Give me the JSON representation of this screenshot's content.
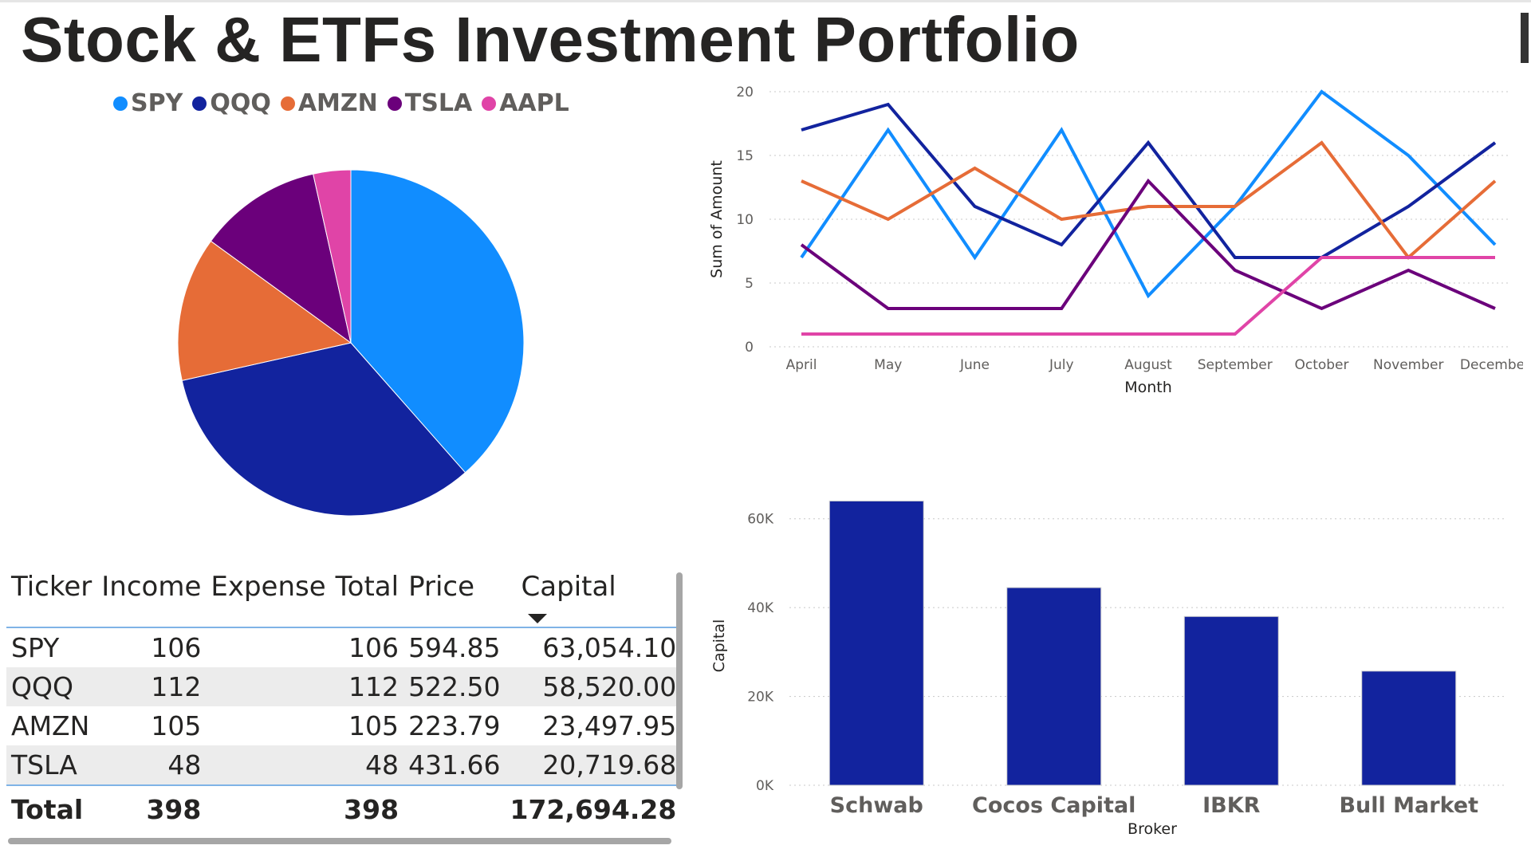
{
  "title": "Stock & ETFs Investment Portfolio",
  "colors": {
    "SPY": "#118dff",
    "QQQ": "#12239e",
    "AMZN": "#e66c37",
    "TSLA": "#6b007b",
    "AAPL": "#e044a7",
    "bar": "#12239e"
  },
  "legend": [
    "SPY",
    "QQQ",
    "AMZN",
    "TSLA",
    "AAPL"
  ],
  "chart_data": [
    {
      "type": "pie",
      "categories": [
        "SPY",
        "QQQ",
        "AMZN",
        "TSLA",
        "AAPL"
      ],
      "values": [
        38.5,
        33.0,
        13.5,
        11.5,
        3.5
      ],
      "legend_position": "top"
    },
    {
      "type": "line",
      "x": [
        "April",
        "May",
        "June",
        "July",
        "August",
        "September",
        "October",
        "November",
        "December"
      ],
      "series": [
        {
          "name": "SPY",
          "values": [
            7,
            17,
            7,
            17,
            4,
            11,
            20,
            15,
            8
          ]
        },
        {
          "name": "QQQ",
          "values": [
            17,
            19,
            11,
            8,
            16,
            7,
            7,
            11,
            16
          ]
        },
        {
          "name": "AMZN",
          "values": [
            13,
            10,
            14,
            10,
            11,
            11,
            16,
            7,
            13
          ]
        },
        {
          "name": "TSLA",
          "values": [
            8,
            3,
            3,
            3,
            13,
            6,
            3,
            6,
            3
          ]
        },
        {
          "name": "AAPL",
          "values": [
            1,
            1,
            1,
            1,
            1,
            1,
            7,
            7,
            7
          ]
        }
      ],
      "xlabel": "Month",
      "ylabel": "Sum of Amount",
      "ylim": [
        0,
        20
      ],
      "yticks": [
        "0",
        "5",
        "10",
        "15",
        "20"
      ],
      "grid": true
    },
    {
      "type": "bar",
      "categories": [
        "Schwab",
        "Cocos Capital",
        "IBKR",
        "Bull Market"
      ],
      "values": [
        64000,
        44500,
        38000,
        25700
      ],
      "xlabel": "Broker",
      "ylabel": "Capital",
      "ylim": [
        0,
        70000
      ],
      "yticks": [
        "0K",
        "20K",
        "40K",
        "60K"
      ],
      "grid": true
    }
  ],
  "table": {
    "headers": [
      "Ticker",
      "Income",
      "Expense",
      "Total",
      "Price",
      "Capital"
    ],
    "rows": [
      [
        "SPY",
        "106",
        "",
        "106",
        "594.85",
        "63,054.10"
      ],
      [
        "QQQ",
        "112",
        "",
        "112",
        "522.50",
        "58,520.00"
      ],
      [
        "AMZN",
        "105",
        "",
        "105",
        "223.79",
        "23,497.95"
      ],
      [
        "TSLA",
        "48",
        "",
        "48",
        "431.66",
        "20,719.68"
      ]
    ],
    "total": [
      "Total",
      "398",
      "",
      "398",
      "",
      "172,694.28"
    ]
  }
}
